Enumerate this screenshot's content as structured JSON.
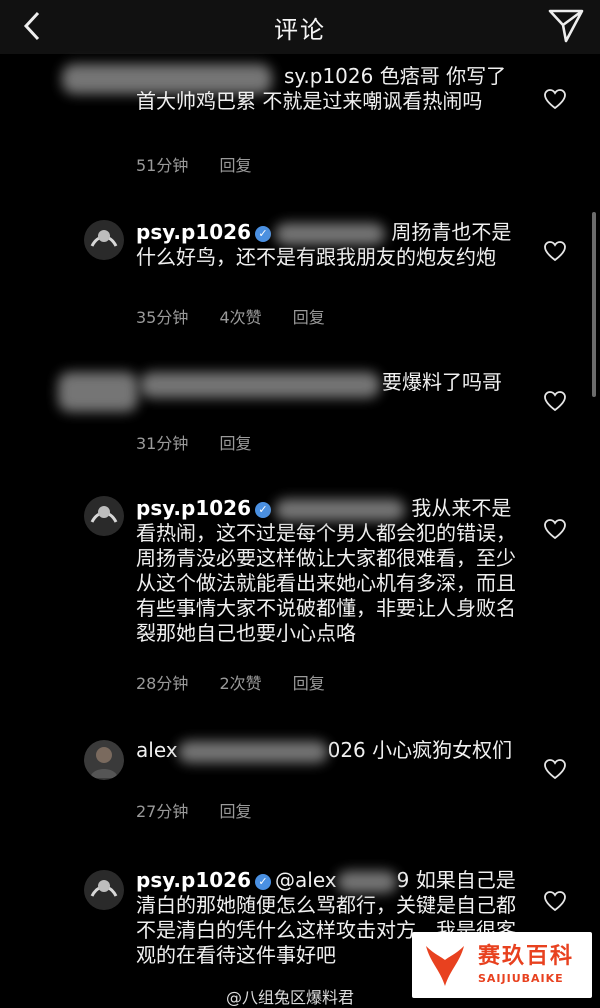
{
  "header": {
    "title": "评论"
  },
  "comments": [
    {
      "username": "",
      "mention": "sy.p1026",
      "text": "色痞哥 你写了首大帅鸡巴累 不就是过来嘲讽看热闹吗",
      "time": "51分钟",
      "likes": "",
      "reply": "回复"
    },
    {
      "username": "psy.p1026",
      "mention": "",
      "text": "周扬青也不是什么好鸟，还不是有跟我朋友的炮友约炮",
      "time": "35分钟",
      "likes": "4次赞",
      "reply": "回复"
    },
    {
      "username": "",
      "mention": "",
      "text": "要爆料了吗哥",
      "time": "31分钟",
      "likes": "",
      "reply": "回复"
    },
    {
      "username": "psy.p1026",
      "mention": "",
      "text": "我从来不是看热闹，这不过是每个男人都会犯的错误，周扬青没必要这样做让大家都很难看，至少从这个做法就能看出来她心机有多深，而且有些事情大家不说破都懂，非要让人身败名裂那她自己也要小心点咯",
      "time": "28分钟",
      "likes": "2次赞",
      "reply": "回复"
    },
    {
      "username": "alex",
      "mention": "026",
      "text": "小心疯狗女权们",
      "time": "27分钟",
      "likes": "",
      "reply": "回复"
    },
    {
      "username": "psy.p1026",
      "mention": "@alex",
      "text": "9 如果自己是清白的那她随便怎么骂都行，关键是自己都不是清白的凭什么这样攻击对方，我是很客观的在看待这件事好吧",
      "time": "",
      "likes": "",
      "reply": ""
    }
  ],
  "watermark": {
    "source": "@八组兔区爆料君",
    "logo_cn": "赛玖百科",
    "logo_en": "SAIJIUBAIKE"
  },
  "colors": {
    "background": "#000000",
    "header": "#111111",
    "verified": "#4a90e2",
    "meta": "#9a9a9a",
    "watermark_logo": "#e8411f"
  },
  "icons": [
    "back-arrow-icon",
    "send-icon",
    "heart-icon",
    "verified-icon"
  ]
}
